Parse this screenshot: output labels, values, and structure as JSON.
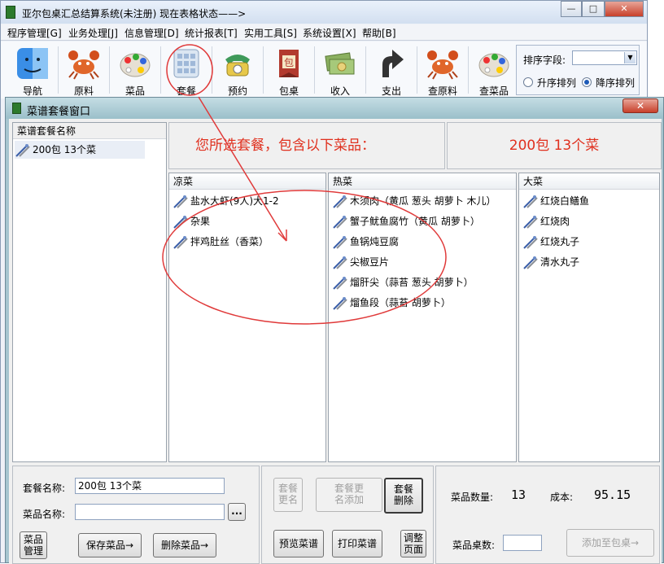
{
  "app": {
    "title": "亚尔包桌汇总结算系统(未注册)  现在表格状态——>",
    "win_min": "—",
    "win_max": "□",
    "win_close": "✕"
  },
  "menu": [
    {
      "label": "程序管理[G]"
    },
    {
      "label": "业务处理[J]"
    },
    {
      "label": "信息管理[D]"
    },
    {
      "label": "统计报表[T]"
    },
    {
      "label": "实用工具[S]"
    },
    {
      "label": "系统设置[X]"
    },
    {
      "label": "帮助[B]"
    }
  ],
  "toolbar": [
    {
      "label": "导航",
      "icon": "finder-face-icon",
      "color": "#3a8ee6"
    },
    {
      "label": "原料",
      "icon": "crab-icon",
      "color": "#e0662a"
    },
    {
      "label": "菜品",
      "icon": "palette-icon",
      "color": "#d8d0c2"
    },
    {
      "label": "套餐",
      "icon": "table-grid-icon",
      "color": "#9fb8d8"
    },
    {
      "label": "预约",
      "icon": "telephone-icon",
      "color": "#3f9a5a"
    },
    {
      "label": "包桌",
      "icon": "banner-icon",
      "color": "#b23a2e"
    },
    {
      "label": "收入",
      "icon": "money-icon",
      "color": "#8bb060"
    },
    {
      "label": "支出",
      "icon": "arrow-up-icon",
      "color": "#333333"
    },
    {
      "label": "查原料",
      "icon": "crab-icon",
      "color": "#e0662a"
    },
    {
      "label": "查菜品",
      "icon": "palette-icon",
      "color": "#d8d0c2"
    }
  ],
  "sort": {
    "label": "排序字段:",
    "value": "",
    "asc_label": "升序排列",
    "desc_label": "降序排列",
    "selected": "desc"
  },
  "window": {
    "title": "菜谱套餐窗口",
    "close": "✕"
  },
  "package_list": {
    "header": "菜谱套餐名称",
    "items": [
      "200包 13个菜"
    ]
  },
  "banner": {
    "message": "您所选套餐，包含以下菜品：",
    "selected_package": "200包  13个菜"
  },
  "columns": [
    {
      "header": "凉菜",
      "items": [
        "盐水大虾(9人)大1-2",
        "杂果",
        "拌鸡肚丝（香菜）"
      ]
    },
    {
      "header": "热菜",
      "items": [
        "木须肉（黄瓜 葱头 胡萝卜 木儿）",
        "蟹子鱿鱼腐竹（黄瓜 胡萝卜）",
        "鱼锅炖豆腐",
        "尖椒豆片",
        "熘肝尖（蒜苔 葱头 胡萝卜）",
        "熘鱼段（蒜苔 胡萝卜）"
      ]
    },
    {
      "header": "大菜",
      "items": [
        "红烧白鳝鱼",
        "红烧肉",
        "红烧丸子",
        "清水丸子"
      ]
    }
  ],
  "form": {
    "package_name_label": "套餐名称:",
    "package_name_value": "200包 13个菜",
    "dish_name_label": "菜品名称:",
    "dish_name_value": "",
    "browse_label": "...",
    "dish_mgmt_line1": "菜品",
    "dish_mgmt_line2": "管理",
    "save_dish": "保存菜品→",
    "delete_dish": "删除菜品→"
  },
  "actions": {
    "rename_line1": "套餐",
    "rename_line2": "更名",
    "rename_add_line1": "套餐更",
    "rename_add_line2": "名添加",
    "delete_line1": "套餐",
    "delete_line2": "删除",
    "preview": "预览菜谱",
    "print": "打印菜谱",
    "adjust_line1": "调整",
    "adjust_line2": "页面"
  },
  "stats": {
    "dish_count_label": "菜品数量:",
    "dish_count": "13",
    "cost_label": "成本:",
    "cost": "95.15",
    "tables_label": "菜品桌数:",
    "tables_value": "",
    "add_to_banquet": "添加至包桌→"
  },
  "colors": {
    "annotation": "#e03a3a",
    "banner_text": "#e0301e"
  }
}
